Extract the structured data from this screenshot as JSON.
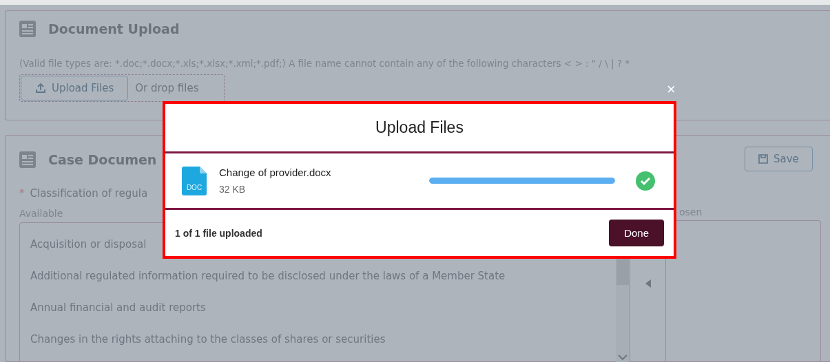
{
  "document_upload": {
    "title": "Document Upload",
    "hint": "(Valid file types are: *.doc;*.docx;*.xls;*.xlsx;*.xml;*.pdf;) A file name cannot contain any of the following characters < > : \" / \\ | ? *",
    "upload_button": "Upload Files",
    "drop_text": "Or drop files"
  },
  "case_documents": {
    "title": "Case Documen",
    "save_button": "Save",
    "required_mark": "*",
    "field_label": "Classification of regula",
    "available_label": "Available",
    "available_items": [
      "Acquisition or disposal",
      "Additional regulated information required to be disclosed under the laws of a Member State",
      "Annual financial and audit reports",
      "Changes in the rights attaching to the classes of shares or securities"
    ],
    "chosen_label": "osen"
  },
  "modal": {
    "close": "×",
    "title": "Upload Files",
    "files": [
      {
        "name": "Change of provider.docx",
        "size": "32 KB",
        "type_label": "DOC",
        "level": 1,
        "done": true
      }
    ],
    "status": "1 of 1 file uploaded",
    "done_button": "Done"
  }
}
